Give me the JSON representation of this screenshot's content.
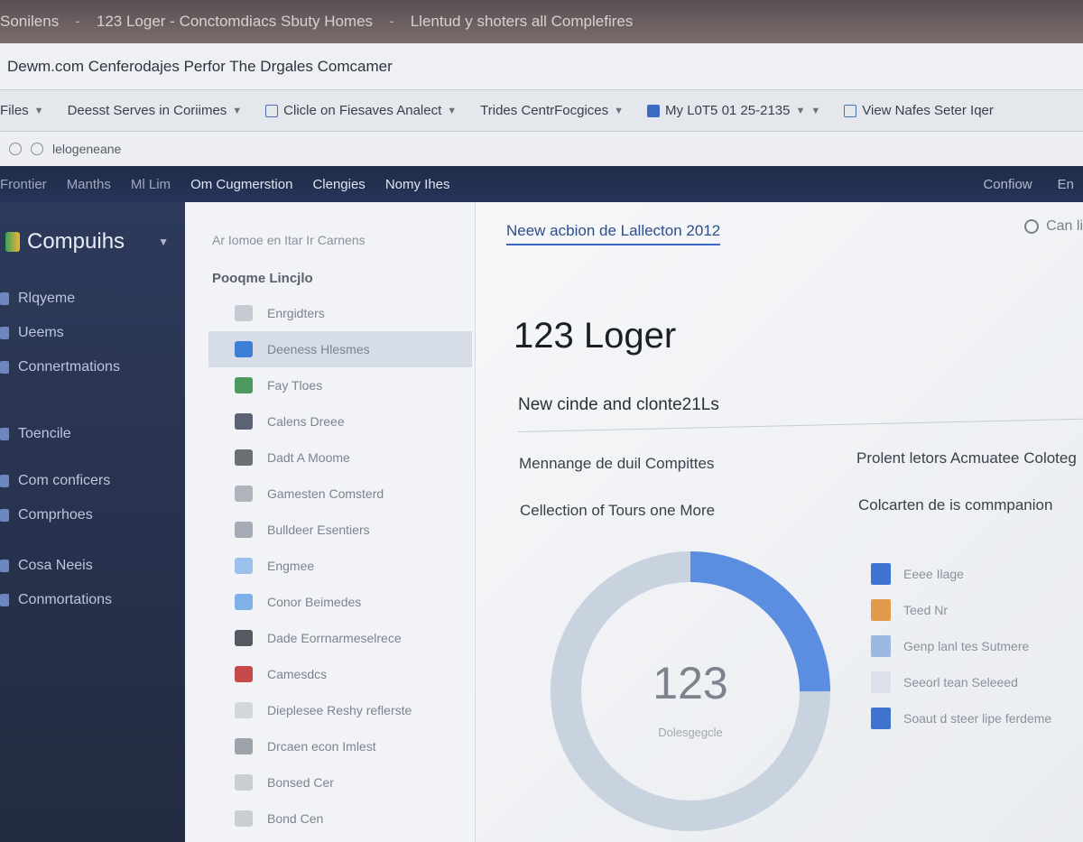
{
  "window": {
    "tabs": [
      "Sonilens",
      "123 Loger - Conctomdiacs Sbuty Homes",
      "Llentud y shoters all Complefires"
    ]
  },
  "address": {
    "text": "Dewm.com Cenferodajes Perfor The Drgales Comcamer"
  },
  "bookmarks": [
    {
      "label": "Files",
      "icon": "none"
    },
    {
      "label": "Deesst Serves in Coriimes",
      "icon": "none"
    },
    {
      "label": "Clicle on Fiesaves Analect",
      "icon": "outline"
    },
    {
      "label": "Trides CentrFocgices",
      "icon": "none"
    },
    {
      "label": "My L0T5 01 25-2135",
      "icon": "fill"
    },
    {
      "label": "View Nafes Seter Iqer",
      "icon": "outline"
    }
  ],
  "tools": {
    "label": "lelogeneane"
  },
  "appnav": {
    "items": [
      "Frontier",
      "Manths",
      "Ml Lim",
      "Om Cugmerstion",
      "Clengies",
      "Nomy Ihes"
    ],
    "right": [
      "Confiow",
      "En"
    ]
  },
  "sidebar": {
    "brand": "Compuihs",
    "items": [
      "Rlqyeme",
      "Ueems",
      "Connertmations"
    ],
    "items2": [
      "Toencile",
      "Com conficers",
      "Comprhoes"
    ],
    "items3": [
      "Cosa Neeis",
      "Conmortations"
    ]
  },
  "secondary": {
    "crumb": "Ar Iomoe en Itar Ir Carnens",
    "heading": "Pooqme Lincjlo",
    "items": [
      {
        "label": "Enrgidters",
        "color": "#c5cad3"
      },
      {
        "label": "Deeness Hlesmes",
        "color": "#3d7fd6",
        "active": true
      },
      {
        "label": "Fay Tloes",
        "color": "#4c9a5e"
      },
      {
        "label": "Calens Dreee",
        "color": "#5a6273"
      },
      {
        "label": "Dadt A Moome",
        "color": "#6a6e75"
      },
      {
        "label": "Gamesten Comsterd",
        "color": "#b0b5bd"
      },
      {
        "label": "Bulldeer Esentiers",
        "color": "#a6acb6"
      },
      {
        "label": "Engmee",
        "color": "#9cc0ea"
      },
      {
        "label": "Conor Beimedes",
        "color": "#7fb0e8"
      },
      {
        "label": "Dade Eorrnarmeselrece",
        "color": "#555a62"
      },
      {
        "label": "Camesdcs",
        "color": "#c64a4a"
      },
      {
        "label": "Dieplesee Reshy reflerste",
        "color": "#d3d7dd"
      },
      {
        "label": "Drcaen econ Imlest",
        "color": "#9da3ab"
      },
      {
        "label": "Bonsed Cer",
        "color": "#c9cdd4"
      },
      {
        "label": "Bond Cen",
        "color": "#c9cdd4"
      }
    ]
  },
  "main": {
    "tab": "Neew acbion de Lallecton 2012",
    "search": "Can li",
    "title": "123 Loger",
    "subtitle": "New cinde and clonte21Ls",
    "stats": {
      "left1": "Mennange de duil Compittes",
      "left2": "Cellection of Tours one More",
      "right1": "Prolent letors Acmuatee Coloteg",
      "right2": "Colcarten de is commpanion"
    },
    "donut": {
      "value": "123",
      "sub": "Dolesgegcle"
    },
    "legend": [
      {
        "label": "Eeee Ilage",
        "color": "#3d73d1"
      },
      {
        "label": "Teed Nr",
        "color": "#e39a4a"
      },
      {
        "label": "Genp lanl tes Sutmere",
        "color": "#9db8e0"
      },
      {
        "label": "Seeorl tean Seleeed",
        "color": "#dbe1e8"
      },
      {
        "label": "Soaut d steer lipe ferdeme",
        "color": "#3f74cf"
      }
    ]
  },
  "chart_data": {
    "type": "pie",
    "series": [
      {
        "values": [
          25,
          75
        ]
      }
    ],
    "colors": [
      "#5b8ee0",
      "#c9d3df"
    ]
  }
}
